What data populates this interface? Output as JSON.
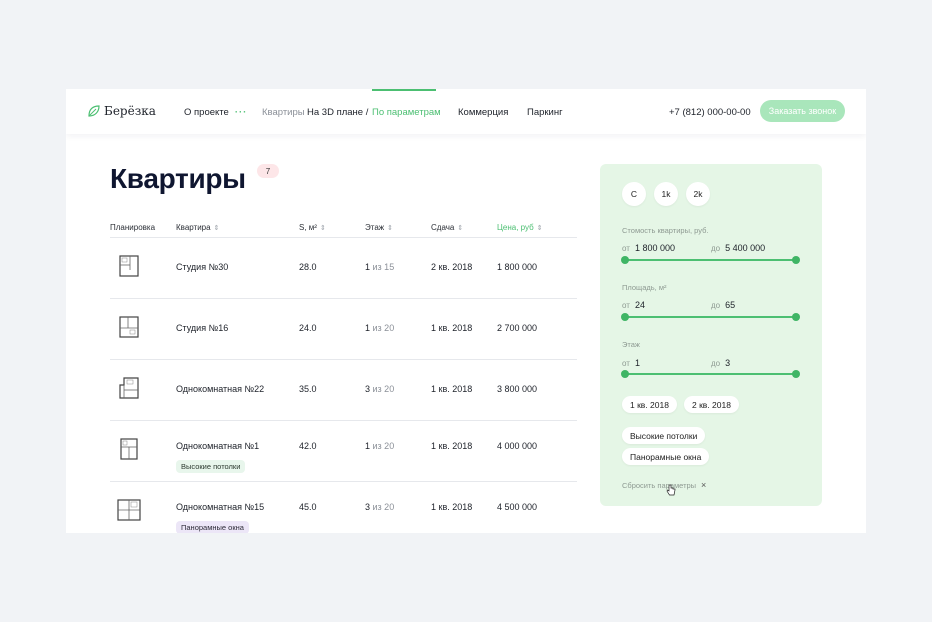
{
  "header": {
    "logo": "Берёзка",
    "nav_about": "О проекте",
    "nav_apartments": "Квартиры",
    "nav_3d": "На 3D плане /",
    "nav_params": "По параметрам",
    "nav_commerce": "Коммерция",
    "nav_parking": "Паркинг",
    "phone": "+7 (812) 000-00-00",
    "cta": "Заказать звонок"
  },
  "title": "Квартиры",
  "count": "7",
  "table": {
    "columns": [
      "Планировка",
      "Квартира",
      "S, м²",
      "Этаж",
      "Сдача",
      "Цена, руб"
    ],
    "rows": [
      {
        "name": "Студия №30",
        "area": "28.0",
        "floor": "1",
        "floor_of": "из 15",
        "delivery": "2 кв. 2018",
        "price": "1 800 000",
        "tag": ""
      },
      {
        "name": "Студия №16",
        "area": "24.0",
        "floor": "1",
        "floor_of": "из 20",
        "delivery": "1 кв. 2018",
        "price": "2 700 000",
        "tag": ""
      },
      {
        "name": "Однокомнатная №22",
        "area": "35.0",
        "floor": "3",
        "floor_of": "из 20",
        "delivery": "1 кв. 2018",
        "price": "3 800 000",
        "tag": ""
      },
      {
        "name": "Однокомнатная №1",
        "area": "42.0",
        "floor": "1",
        "floor_of": "из 20",
        "delivery": "1 кв. 2018",
        "price": "4 000 000",
        "tag": "Высокие потолки"
      },
      {
        "name": "Однокомнатная №15",
        "area": "45.0",
        "floor": "3",
        "floor_of": "из 20",
        "delivery": "1 кв. 2018",
        "price": "4 500 000",
        "tag": "Панорамные окна"
      }
    ]
  },
  "filter": {
    "rooms": [
      "С",
      "1k",
      "2k"
    ],
    "price": {
      "label": "Стомость квартиры, руб.",
      "from_prefix": "от",
      "from": "1 800 000",
      "to_prefix": "до",
      "to": "5 400 000"
    },
    "area": {
      "label": "Площадь, м²",
      "from_prefix": "от",
      "from": "24",
      "to_prefix": "до",
      "to": "65"
    },
    "floor": {
      "label": "Этаж",
      "from_prefix": "от",
      "from": "1",
      "to_prefix": "до",
      "to": "3"
    },
    "delivery": [
      "1 кв. 2018",
      "2 кв. 2018"
    ],
    "features": [
      "Высокие потолки",
      "Панорамные окна"
    ],
    "reset": "Сбросить параметры",
    "reset_icon": "×"
  },
  "colors": {
    "accent": "#4cbf72",
    "panel": "#e5f6e6",
    "badge": "#fde6e8",
    "cta": "#a9e6bb"
  }
}
